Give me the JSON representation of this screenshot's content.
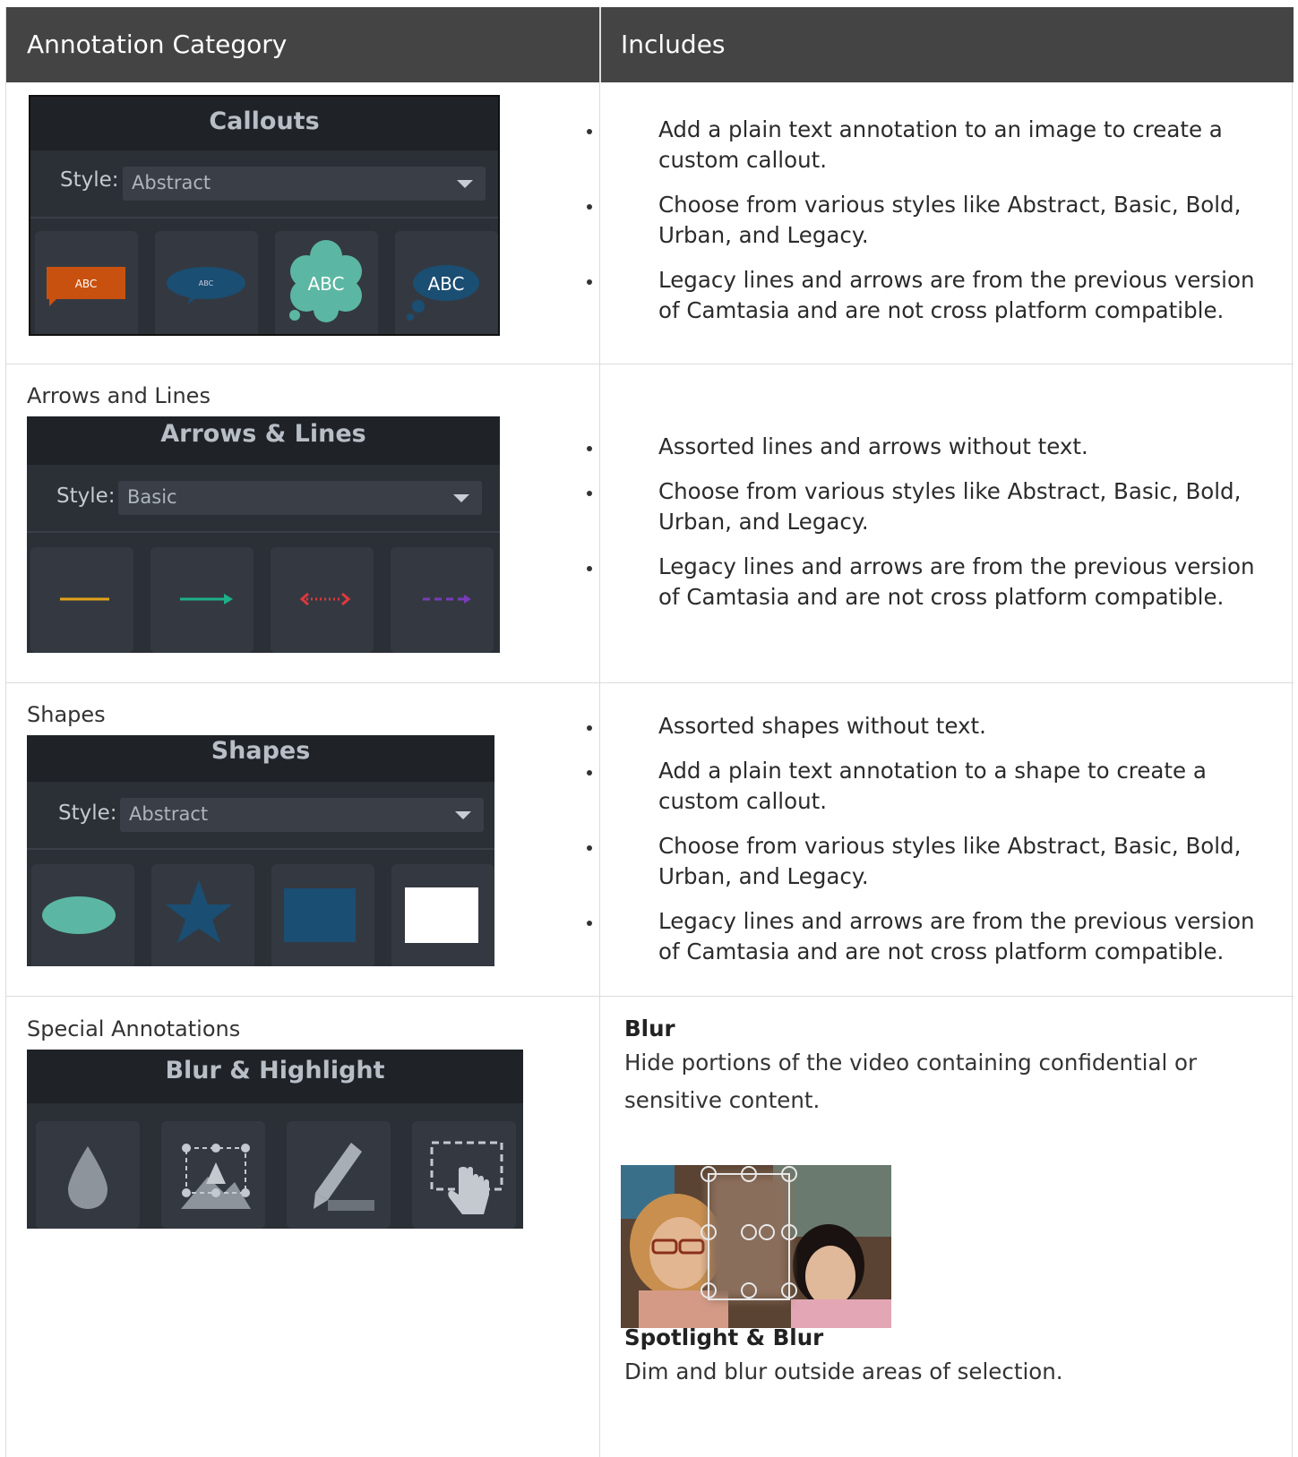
{
  "header": {
    "col1": "Annotation Category",
    "col2": "Includes"
  },
  "rows": {
    "callouts": {
      "label": "",
      "panel_title": "Callouts",
      "style_label": "Style:",
      "style_value": "Abstract",
      "tiles": [
        "ABC",
        "ABC",
        "ABC",
        "ABC"
      ],
      "tile_colors": [
        "#c8510f",
        "#1a4e73",
        "#5bb7a3",
        "#1a4e73"
      ],
      "bullets": [
        "Add a plain text annotation to an image to create a custom callout.",
        "Choose from various styles like Abstract, Basic, Bold, Urban, and Legacy.",
        "Legacy lines and arrows are from the previous version of Camtasia and are not cross platform compatible."
      ]
    },
    "arrows": {
      "label": "Arrows and Lines",
      "panel_title": "Arrows & Lines",
      "style_label": "Style:",
      "style_value": "Basic",
      "line_colors": [
        "#e2a21a",
        "#1db08a",
        "#e0383e",
        "#7a3bb8"
      ],
      "bullets": [
        "Assorted lines and arrows without text.",
        "Choose from various styles like Abstract, Basic, Bold, Urban, and Legacy.",
        "Legacy lines and arrows are from the previous version of Camtasia and are not cross platform compatible."
      ]
    },
    "shapes": {
      "label": "Shapes",
      "panel_title": "Shapes",
      "style_label": "Style:",
      "style_value": "Abstract",
      "shape_colors": [
        "#5bb7a3",
        "#1a4e73",
        "#1a4e73",
        "#ffffff"
      ],
      "bullets": [
        "Assorted shapes without text.",
        "Add a plain text annotation to a shape to create a custom callout.",
        "Choose from various styles like Abstract, Basic, Bold, Urban, and Legacy.",
        "Legacy lines and arrows are from the previous version of Camtasia and are not cross platform compatible."
      ]
    },
    "special": {
      "label": "Special Annotations",
      "panel_title": "Blur & Highlight",
      "icons": [
        "blur-drop-icon",
        "interactive-hotspot-shape-icon",
        "highlight-pen-icon",
        "spotlight-hotspot-icon"
      ],
      "blur_title": "Blur",
      "blur_desc": "Hide portions of the video containing confidential or sensitive content.",
      "spot_title": "Spotlight & Blur",
      "spot_desc": "Dim and blur outside areas of selection."
    }
  }
}
